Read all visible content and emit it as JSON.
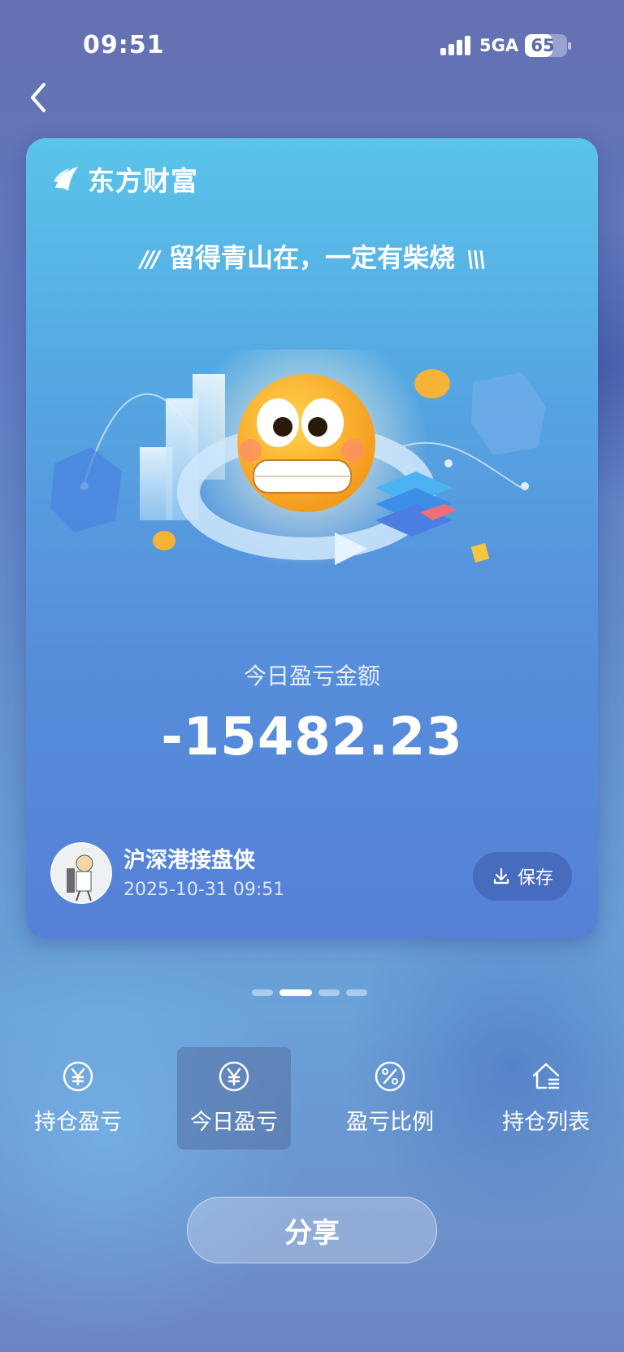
{
  "status_bar": {
    "time": "09:51",
    "network": "5GA",
    "battery": "65",
    "battery_level": 0.65
  },
  "card": {
    "brand": "东方财富",
    "slogan": "留得青山在，一定有柴烧",
    "metric_label": "今日盈亏金额",
    "amount": "-15482.23",
    "user_name": "沪深港接盘侠",
    "timestamp": "2025-10-31 09:51",
    "save_label": "保存"
  },
  "pager": {
    "count": 4,
    "active_index": 1
  },
  "tabs": [
    {
      "label": "持仓盈亏",
      "icon": "yen-circle-icon",
      "active": false
    },
    {
      "label": "今日盈亏",
      "icon": "yen-circle-icon",
      "active": true
    },
    {
      "label": "盈亏比例",
      "icon": "percent-circle-icon",
      "active": false
    },
    {
      "label": "持仓列表",
      "icon": "house-list-icon",
      "active": false
    }
  ],
  "share_label": "分享"
}
